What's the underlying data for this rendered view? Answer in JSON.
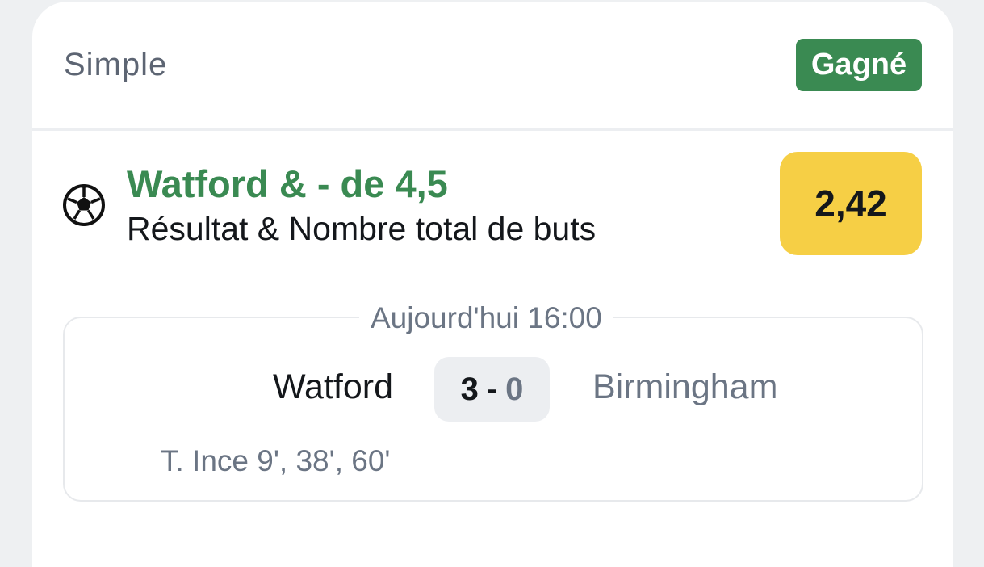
{
  "bet": {
    "type_label": "Simple",
    "status": "Gagné",
    "status_color": "#3a8a52",
    "sport_icon": "soccer-ball-icon",
    "selection": "Watford & - de 4,5",
    "market": "Résultat & Nombre total de buts",
    "odds": "2,42",
    "odds_color": "#f6cf45"
  },
  "match": {
    "datetime": "Aujourd'hui 16:00",
    "home_team": "Watford",
    "away_team": "Birmingham",
    "score": {
      "home": "3",
      "separator": "-",
      "away": "0"
    },
    "scorers": "T. Ince 9', 38', 60'"
  }
}
